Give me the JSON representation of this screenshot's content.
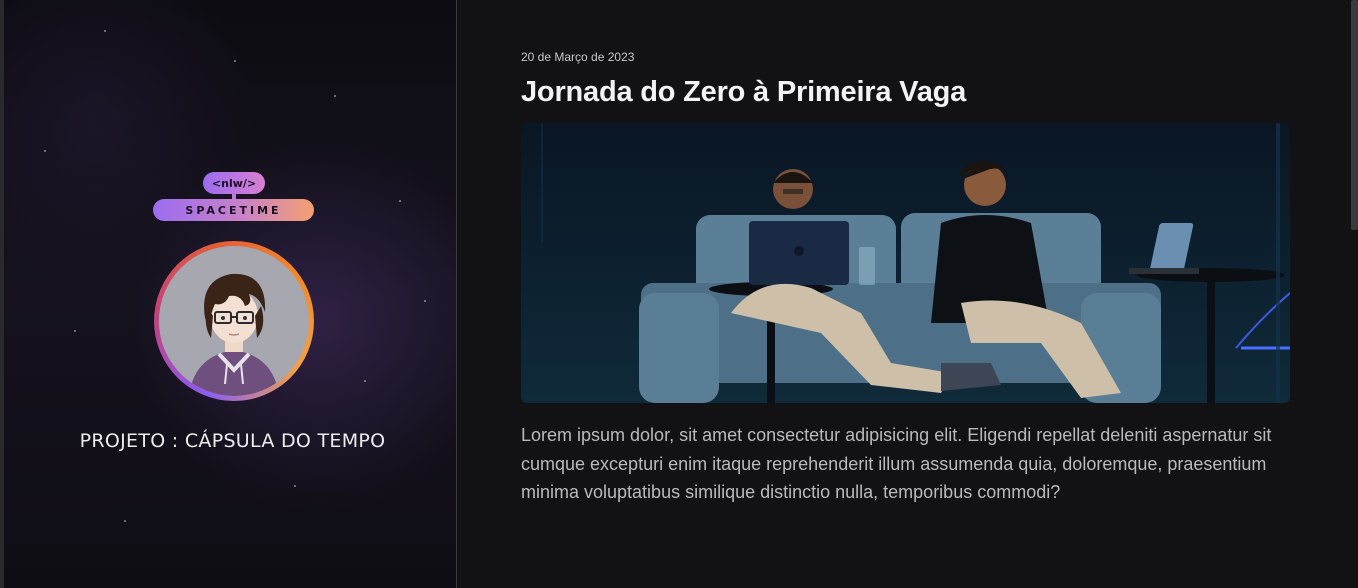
{
  "sidebar": {
    "logo": {
      "tag": "<nlw/>",
      "name": "SPACETIME"
    },
    "avatar_icon": "user-avatar-illustration",
    "project_title": "PROJETO : CÁPSULA DO TEMPO"
  },
  "memory": {
    "date": "20 de Março de 2023",
    "title": "Jornada do Zero à Primeira Vaga",
    "image_icon": "event-photo-two-speakers-on-sofa",
    "text": "Lorem ipsum dolor, sit amet consectetur adipisicing elit. Eligendi repellat deleniti aspernatur sit cumque excepturi enim itaque reprehenderit illum assumenda quia, doloremque, praesentium minima voluptatibus similique distinctio nulla, temporibus commodi?"
  },
  "colors": {
    "background": "#121215",
    "accent_purple": "#9b6cf0",
    "accent_orange": "#f4a070"
  }
}
